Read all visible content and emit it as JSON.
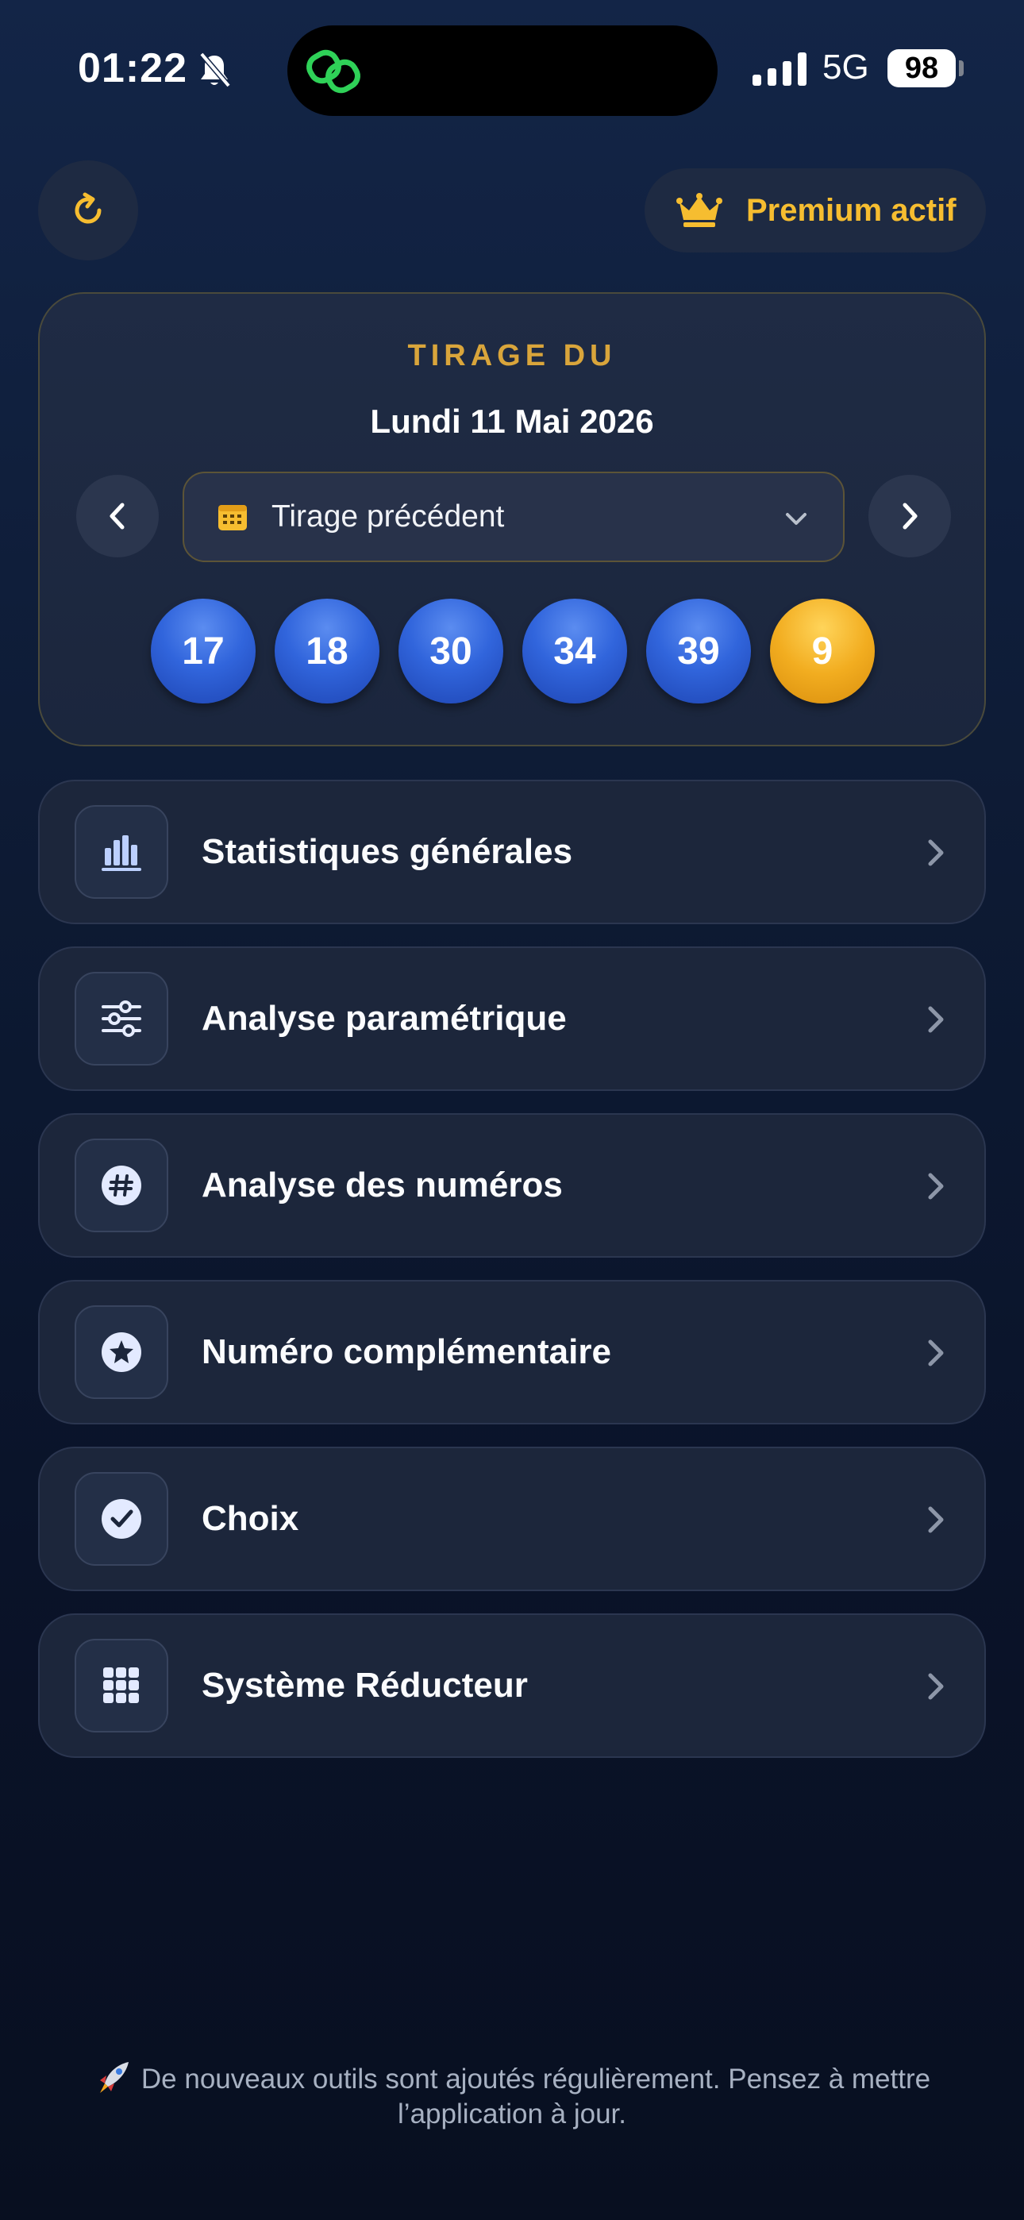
{
  "status_bar": {
    "time": "01:22",
    "network": "5G",
    "battery": "98"
  },
  "header": {
    "premium_label": "Premium actif"
  },
  "draw": {
    "heading": "TIRAGE DU",
    "date": "Lundi 11 Mai 2026",
    "select_label": "Tirage précédent",
    "numbers": [
      "17",
      "18",
      "30",
      "34",
      "39"
    ],
    "bonus": "9"
  },
  "menu": {
    "items": [
      {
        "label": "Statistiques générales",
        "icon": "bar-chart-icon"
      },
      {
        "label": "Analyse paramétrique",
        "icon": "sliders-icon"
      },
      {
        "label": "Analyse des numéros",
        "icon": "hash-icon"
      },
      {
        "label": "Numéro complémentaire",
        "icon": "star-icon"
      },
      {
        "label": "Choix",
        "icon": "check-icon"
      },
      {
        "label": "Système Réducteur",
        "icon": "grid-icon"
      }
    ]
  },
  "footer": {
    "note": "De nouveaux outils sont ajoutés régulièrement. Pensez à mettre l’application à jour."
  },
  "colors": {
    "accent_gold": "#f6bd30",
    "ball_blue": "#3165dc",
    "ball_gold": "#f2ad20",
    "card_bg": "#1c263b"
  }
}
